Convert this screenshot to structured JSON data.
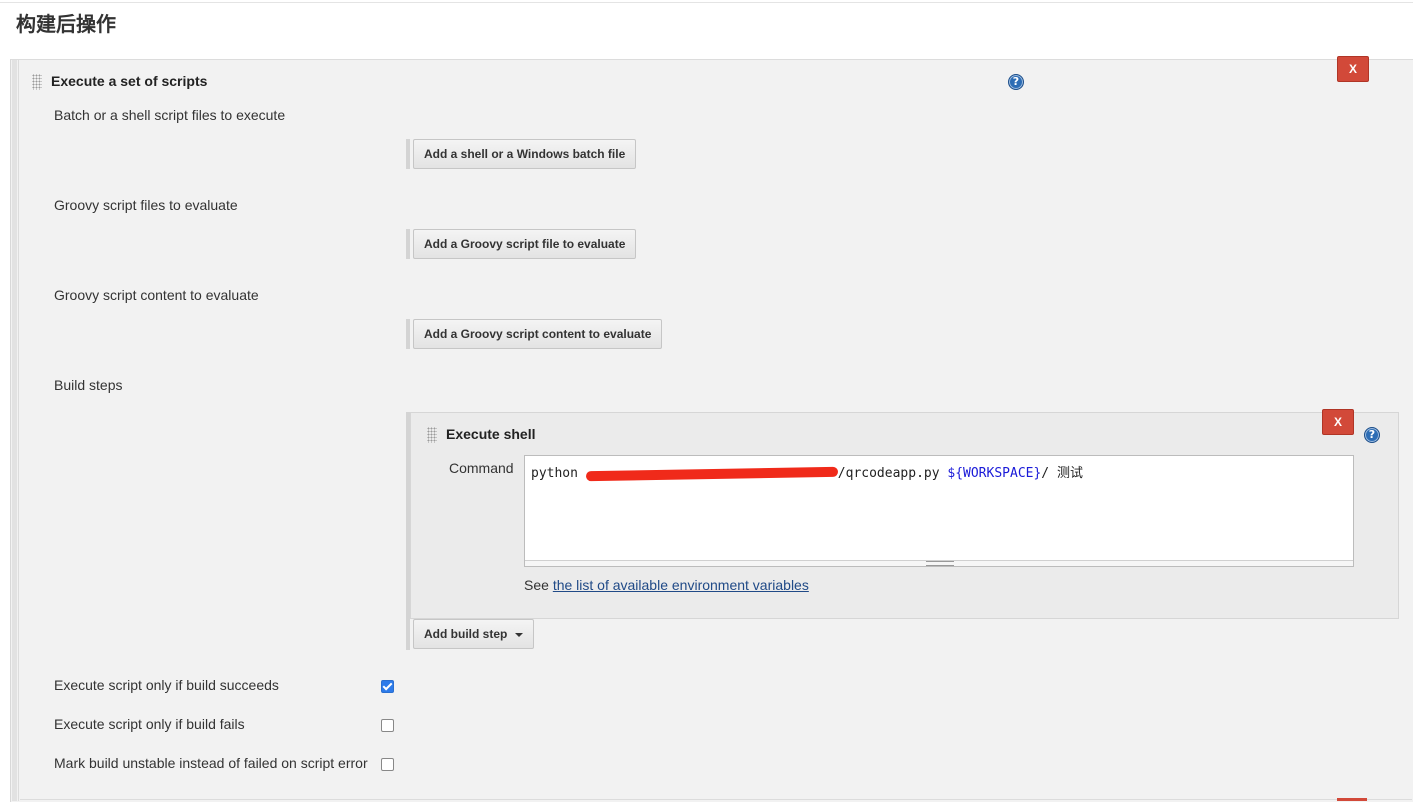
{
  "section": {
    "title": "构建后操作"
  },
  "execute_scripts": {
    "title": "Execute a set of scripts",
    "delete_label": "X",
    "help_label": "?",
    "batch_label": "Batch or a shell script files to execute",
    "add_batch_button": "Add a shell or a Windows batch file",
    "groovy_files_label": "Groovy script files to evaluate",
    "add_groovy_file_button": "Add a Groovy script file to evaluate",
    "groovy_content_label": "Groovy script content to evaluate",
    "add_groovy_content_button": "Add a Groovy script content to evaluate",
    "build_steps_label": "Build steps",
    "add_build_step_button": "Add build step"
  },
  "execute_shell": {
    "title": "Execute shell",
    "delete_label": "X",
    "help_label": "?",
    "command_label": "Command",
    "command_prefix": "python ",
    "command_path_tail": "/qrcodeapp.py ",
    "command_var": "${WORKSPACE}",
    "command_suffix": "/ 测试",
    "see_label": "See",
    "env_link": "the list of available environment variables"
  },
  "options": [
    {
      "label": "Execute script only if build succeeds",
      "checked": true
    },
    {
      "label": "Execute script only if build fails",
      "checked": false
    },
    {
      "label": "Mark build unstable instead of failed on script error",
      "checked": false
    }
  ],
  "colors": {
    "delete_red": "#d24939",
    "redaction": "#f02a1a",
    "link_blue": "#204a87",
    "checkbox_blue": "#2d7bea"
  }
}
